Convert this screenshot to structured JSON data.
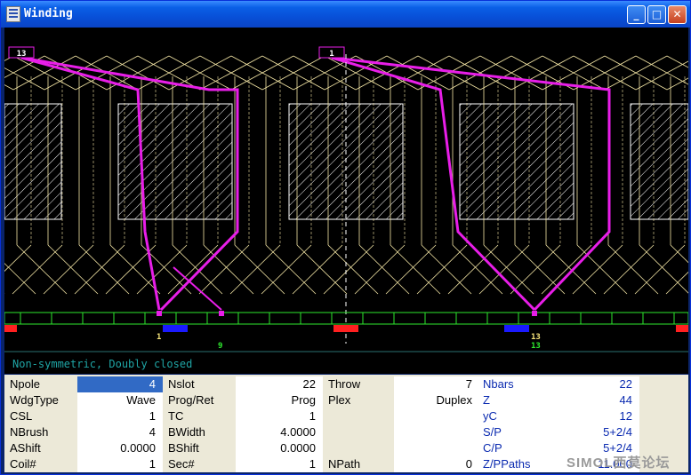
{
  "window": {
    "title": "Winding",
    "icon": "app-grid-icon",
    "minimize_icon": "minimize-icon",
    "maximize_icon": "maximize-icon",
    "close_icon": "close-icon"
  },
  "diagram": {
    "coil_markers": [
      "13",
      "1"
    ],
    "commutator_labels": [
      "1",
      "9",
      "13",
      "13"
    ],
    "colors": {
      "background": "#000000",
      "conductor": "#f5e7a6",
      "highlight": "#e81ee8",
      "slot": "#ffffff",
      "commutator": "#2ee82e",
      "brush_pos": "#ff2020",
      "brush_neg": "#1a1aff"
    }
  },
  "status": {
    "text": "Non-symmetric, Doubly closed"
  },
  "params": {
    "col1": [
      {
        "label": "Npole",
        "value": "4"
      },
      {
        "label": "WdgType",
        "value": "Wave"
      },
      {
        "label": "CSL",
        "value": "1"
      },
      {
        "label": "NBrush",
        "value": "4"
      },
      {
        "label": "AShift",
        "value": "0.0000"
      },
      {
        "label": "Coil#",
        "value": "1"
      }
    ],
    "col2": [
      {
        "label": "Nslot",
        "value": "22"
      },
      {
        "label": "Prog/Ret",
        "value": "Prog"
      },
      {
        "label": "TC",
        "value": "1"
      },
      {
        "label": "BWidth",
        "value": "4.0000"
      },
      {
        "label": "BShift",
        "value": "0.0000"
      },
      {
        "label": "Sec#",
        "value": "1"
      }
    ],
    "col3": [
      {
        "label": "Throw",
        "value": "7"
      },
      {
        "label": "Plex",
        "value": "Duplex"
      },
      {
        "label": "",
        "value": ""
      },
      {
        "label": "",
        "value": ""
      },
      {
        "label": "",
        "value": ""
      },
      {
        "label": "NPath",
        "value": "0"
      }
    ],
    "col4": [
      {
        "label": "Nbars",
        "value": "22"
      },
      {
        "label": "Z",
        "value": "44"
      },
      {
        "label": "yC",
        "value": "12"
      },
      {
        "label": "S/P",
        "value": "5+2/4"
      },
      {
        "label": "C/P",
        "value": "5+2/4"
      },
      {
        "label": "Z/PPaths",
        "value": "11.000"
      }
    ]
  },
  "watermark": {
    "text": "SIMOL西莫论坛"
  }
}
